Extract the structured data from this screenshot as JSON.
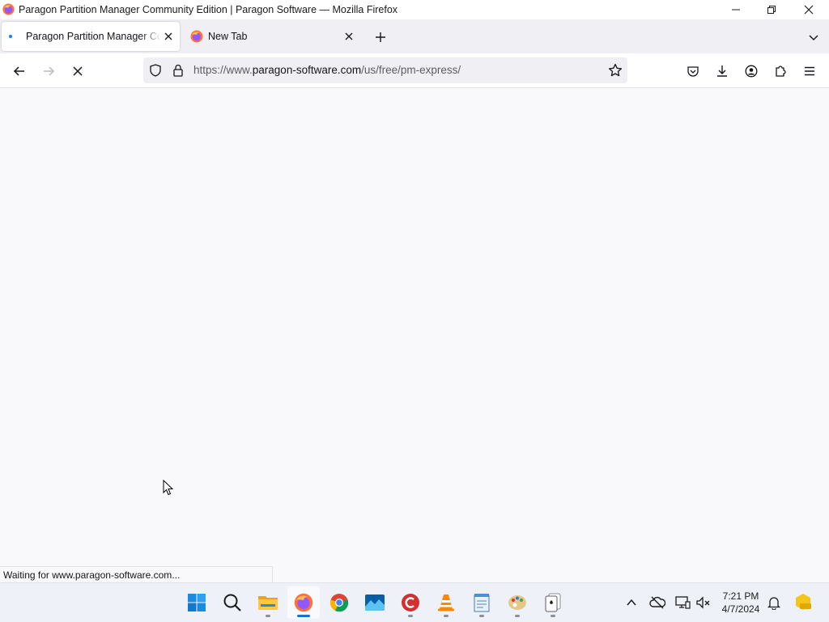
{
  "window": {
    "title": "Paragon Partition Manager Community Edition | Paragon Software — Mozilla Firefox",
    "controls": [
      "minimize",
      "restore",
      "close"
    ]
  },
  "tabs": [
    {
      "label": "Paragon Partition Manager Community Edition | Paragon Software",
      "active": true,
      "loading": true
    },
    {
      "label": "New Tab",
      "active": false
    }
  ],
  "navbar": {
    "url_prefix": "https://www.",
    "url_host": "paragon-software.com",
    "url_path": "/us/free/pm-express/"
  },
  "status": {
    "text": "Waiting for www.paragon-software.com..."
  },
  "taskbar": {
    "apps": [
      "start-icon",
      "search-icon",
      "file-explorer-icon",
      "firefox-icon",
      "chrome-icon",
      "photo-viewer-icon",
      "ccleaner-icon",
      "vlc-icon",
      "notepad-icon",
      "paint-icon",
      "solitaire-icon"
    ],
    "active_app": "firefox-icon",
    "clock_time": "7:21 PM",
    "clock_date": "4/7/2024"
  },
  "colors": {
    "accent": "#0a84ff",
    "tab_strip": "#f0f0f4",
    "taskbar": "#eef2f8"
  }
}
